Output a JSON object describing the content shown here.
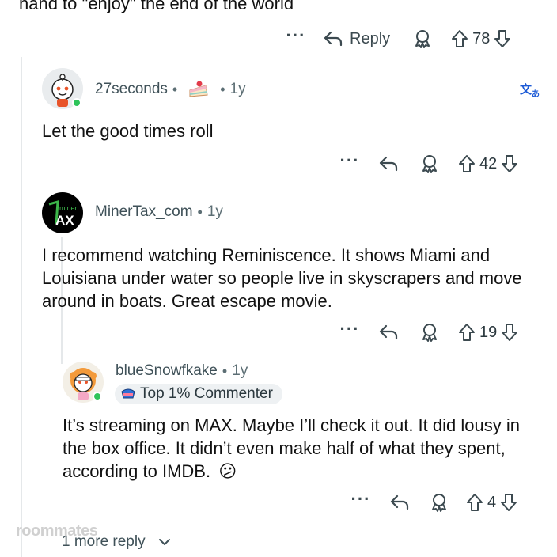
{
  "top_text": "hand to \"enjoy\" the end of the world",
  "parent_actions": {
    "reply_label": "Reply",
    "votes": "78"
  },
  "comments": [
    {
      "username": "27seconds",
      "sep": "•",
      "time": "1y",
      "text": "Let the good times roll",
      "votes": "42",
      "flair_icon": "cake-icon",
      "translate_icon": "translate-icon"
    },
    {
      "username": "MinerTax_com",
      "sep": "•",
      "time": "1y",
      "avatar_text_top": "miner",
      "avatar_text_main": "AX",
      "text": "I recommend watching Reminiscence. It shows Miami and Louisiana under water so people live in skyscrapers and move around in boats. Great escape movie.",
      "votes": "19"
    },
    {
      "username": "blueSnowfkake",
      "sep": "•",
      "time": "1y",
      "badge": "Top 1% Commenter",
      "text": "It’s streaming on MAX.  Maybe I’ll check it out. It did lousy in the box office. It didn’t even make half of what they spent, according to IMDB.",
      "emoji": "😕",
      "votes": "4"
    }
  ],
  "more_replies": "1 more reply",
  "watermark": "roommates",
  "colors": {
    "online": "#2ec45a",
    "translate": "#1d5bd6",
    "thread": "#e5e8ea"
  }
}
